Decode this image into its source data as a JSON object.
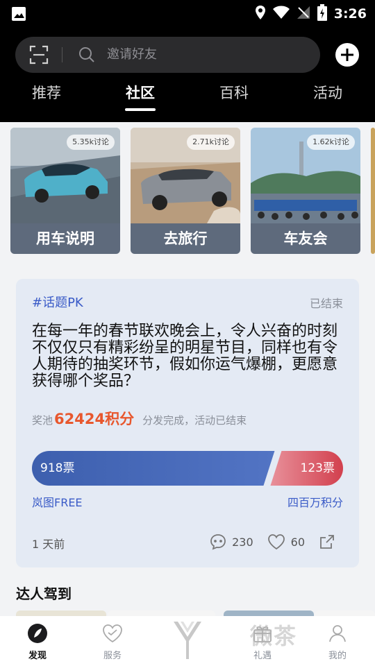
{
  "status_bar": {
    "time": "3:26"
  },
  "header": {
    "search_placeholder": "邀请好友",
    "tabs": [
      {
        "label": "推荐"
      },
      {
        "label": "社区"
      },
      {
        "label": "百科"
      },
      {
        "label": "活动"
      }
    ],
    "active_tab": "社区"
  },
  "categories": [
    {
      "label": "用车说明",
      "badge": "5.35k讨论"
    },
    {
      "label": "去旅行",
      "badge": "2.71k讨论"
    },
    {
      "label": "车友会",
      "badge": "1.62k讨论"
    }
  ],
  "pk_card": {
    "topic": "#话题PK",
    "status": "已结束",
    "question": "在每一年的春节联欢晚会上，令人兴奋的时刻不仅仅只有精彩纷呈的明星节目，同样也有令人期待的抽奖环节，假如你运气爆棚，更愿意获得哪个奖品？",
    "prize_label": "奖池",
    "prize_amount": "62424积分",
    "prize_note": "分发完成，活动已结束",
    "left_votes": "918票",
    "right_votes": "123票",
    "left_votes_value": 918,
    "right_votes_value": 123,
    "left_option": "岚图FREE",
    "right_option": "四百万积分",
    "time": "1 天前",
    "comments": "230",
    "likes": "60"
  },
  "section_title": "达人驾到",
  "bottom_nav": [
    {
      "label": "发现"
    },
    {
      "label": "服务"
    },
    {
      "label": ""
    },
    {
      "label": "礼遇"
    },
    {
      "label": "我的"
    }
  ],
  "watermark": "微茶"
}
